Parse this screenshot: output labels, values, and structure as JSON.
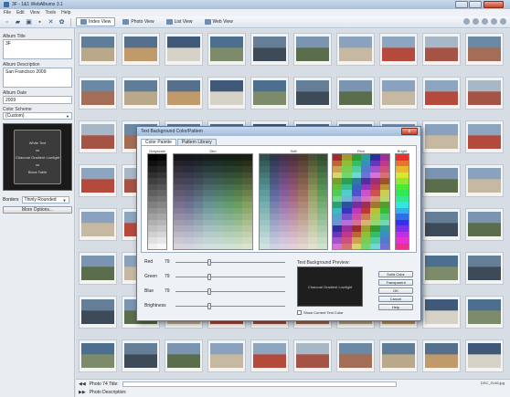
{
  "window": {
    "title": "3F - 1&1 WebAlbums 3.1"
  },
  "menu": [
    "File",
    "Edit",
    "View",
    "Tools",
    "Help"
  ],
  "toolbar": {
    "views": [
      {
        "label": "Index View",
        "active": true
      },
      {
        "label": "Photo View",
        "active": false
      },
      {
        "label": "List View",
        "active": false
      },
      {
        "label": "Web View",
        "active": false
      }
    ]
  },
  "left_panel": {
    "album_title_label": "Album Title",
    "album_title_value": "3F",
    "album_description_label": "Album Description",
    "album_description_value": "San Francisco 2009",
    "album_date_label": "Album Date",
    "album_date_value": "2009",
    "color_scheme_label": "Color Scheme",
    "color_scheme_value": "(Custom)",
    "preview_lines": [
      "White Text",
      "on",
      "Charcoal Gradient Lowlight",
      "on",
      "Black Table"
    ],
    "borders_label": "Borders",
    "borders_value": "Thinly Rounded",
    "more_options_label": "More Options..."
  },
  "bottom": {
    "photo_title_label": "Photo 74 Title:",
    "photo_description_label": "Photo Description:",
    "filename": "DSC_0146.jpg"
  },
  "dialog": {
    "title": "Text Background Color/Pattern",
    "close_label": "x",
    "tabs": [
      {
        "label": "Color Palette",
        "active": true
      },
      {
        "label": "Pattern Library",
        "active": false
      }
    ],
    "palette_groups": [
      "Grayscale",
      "Dim",
      "Soft",
      "Rich",
      "Bright"
    ],
    "sliders": [
      {
        "label": "Red",
        "value": "79",
        "fraction": 0.31
      },
      {
        "label": "Green",
        "value": "79",
        "fraction": 0.31
      },
      {
        "label": "Blue",
        "value": "79",
        "fraction": 0.31
      },
      {
        "label": "Brightness",
        "value": "",
        "fraction": 0.31
      }
    ],
    "preview_label": "Text Background Preview:",
    "preview_text": "Charcoal Gradient Lowlight",
    "show_current_label": "Show Current Text Color",
    "buttons": [
      "Solid Color",
      "Transparent",
      "OK",
      "Cancel",
      "Help"
    ]
  }
}
